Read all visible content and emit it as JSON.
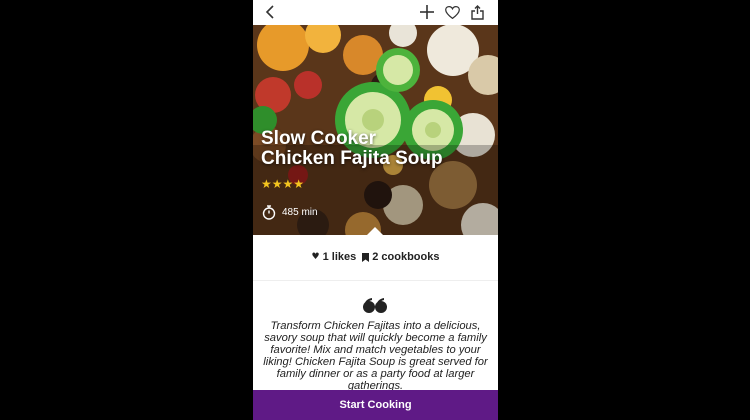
{
  "topbar": {
    "back_icon": "chevron-left-icon",
    "add_icon": "plus-icon",
    "favorite_icon": "heart-outline-icon",
    "share_icon": "share-icon"
  },
  "recipe": {
    "title_line1": "Slow Cooker",
    "title_line2": "Chicken Fajita Soup",
    "rating_stars": "★★★★",
    "rating": 4,
    "cook_time": "485 min",
    "timer_icon": "stopwatch-icon"
  },
  "stats": {
    "likes_label": "1 likes",
    "cookbooks_label": "2 cookbooks",
    "likes_icon": "heart-icon",
    "cookbooks_icon": "bookmark-icon"
  },
  "description": {
    "quote_icon": "quote-icon",
    "text": "Transform Chicken Fajitas into a delicious, savory soup that will quickly become a family favorite! Mix and match vegetables to your liking! Chicken Fajita Soup is great served for family dinner or as a party food at larger gatherings."
  },
  "cta": {
    "label": "Start Cooking"
  },
  "colors": {
    "accent": "#5f1a86",
    "star": "#f4c51f",
    "background": "#000000"
  }
}
